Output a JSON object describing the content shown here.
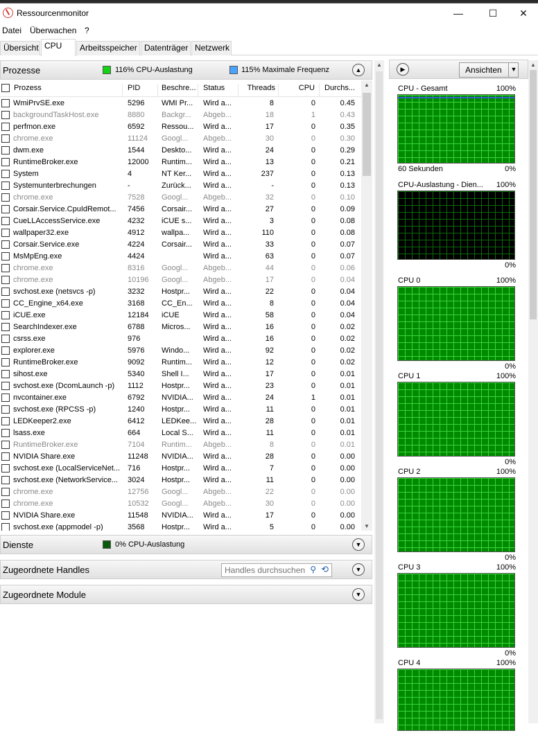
{
  "window": {
    "title": "Ressourcenmonitor",
    "minimize": "—",
    "maximize": "☐",
    "close": "✕"
  },
  "menu": [
    "Datei",
    "Überwachen",
    "?"
  ],
  "tabs": [
    "Übersicht",
    "CPU",
    "Arbeitsspeicher",
    "Datenträger",
    "Netzwerk"
  ],
  "prozesse": {
    "title": "Prozesse",
    "stat1": "116% CPU-Auslastung",
    "stat2": "115% Maximale Frequenz",
    "columns": [
      "Prozess",
      "PID",
      "Beschre...",
      "Status",
      "Threads",
      "CPU",
      "Durchs..."
    ],
    "rows": [
      [
        "WmiPrvSE.exe",
        "5296",
        "WMI Pr...",
        "Wird a...",
        "8",
        "0",
        "0.45",
        false
      ],
      [
        "backgroundTaskHost.exe",
        "8880",
        "Backgr...",
        "Abgeb...",
        "18",
        "1",
        "0.43",
        true
      ],
      [
        "perfmon.exe",
        "6592",
        "Ressou...",
        "Wird a...",
        "17",
        "0",
        "0.35",
        false
      ],
      [
        "chrome.exe",
        "11124",
        "Googl...",
        "Abgeb...",
        "30",
        "0",
        "0.30",
        true
      ],
      [
        "dwm.exe",
        "1544",
        "Deskto...",
        "Wird a...",
        "24",
        "0",
        "0.29",
        false
      ],
      [
        "RuntimeBroker.exe",
        "12000",
        "Runtim...",
        "Wird a...",
        "13",
        "0",
        "0.21",
        false
      ],
      [
        "System",
        "4",
        "NT Ker...",
        "Wird a...",
        "237",
        "0",
        "0.13",
        false
      ],
      [
        "Systemunterbrechungen",
        "-",
        "Zurück...",
        "Wird a...",
        "-",
        "0",
        "0.13",
        false
      ],
      [
        "chrome.exe",
        "7528",
        "Googl...",
        "Abgeb...",
        "32",
        "0",
        "0.10",
        true
      ],
      [
        "Corsair.Service.CpuIdRemot...",
        "7456",
        "Corsair...",
        "Wird a...",
        "27",
        "0",
        "0.09",
        false
      ],
      [
        "CueLLAccessService.exe",
        "4232",
        "iCUE s...",
        "Wird a...",
        "3",
        "0",
        "0.08",
        false
      ],
      [
        "wallpaper32.exe",
        "4912",
        "wallpa...",
        "Wird a...",
        "110",
        "0",
        "0.08",
        false
      ],
      [
        "Corsair.Service.exe",
        "4224",
        "Corsair...",
        "Wird a...",
        "33",
        "0",
        "0.07",
        false
      ],
      [
        "MsMpEng.exe",
        "4424",
        "",
        "Wird a...",
        "63",
        "0",
        "0.07",
        false
      ],
      [
        "chrome.exe",
        "8316",
        "Googl...",
        "Abgeb...",
        "44",
        "0",
        "0.06",
        true
      ],
      [
        "chrome.exe",
        "10196",
        "Googl...",
        "Abgeb...",
        "17",
        "0",
        "0.04",
        true
      ],
      [
        "svchost.exe (netsvcs -p)",
        "3232",
        "Hostpr...",
        "Wird a...",
        "22",
        "0",
        "0.04",
        false
      ],
      [
        "CC_Engine_x64.exe",
        "3168",
        "CC_En...",
        "Wird a...",
        "8",
        "0",
        "0.04",
        false
      ],
      [
        "iCUE.exe",
        "12184",
        "iCUE",
        "Wird a...",
        "58",
        "0",
        "0.04",
        false
      ],
      [
        "SearchIndexer.exe",
        "6788",
        "Micros...",
        "Wird a...",
        "16",
        "0",
        "0.02",
        false
      ],
      [
        "csrss.exe",
        "976",
        "",
        "Wird a...",
        "16",
        "0",
        "0.02",
        false
      ],
      [
        "explorer.exe",
        "5976",
        "Windo...",
        "Wird a...",
        "92",
        "0",
        "0.02",
        false
      ],
      [
        "RuntimeBroker.exe",
        "9092",
        "Runtim...",
        "Wird a...",
        "12",
        "0",
        "0.02",
        false
      ],
      [
        "sihost.exe",
        "5340",
        "Shell I...",
        "Wird a...",
        "17",
        "0",
        "0.01",
        false
      ],
      [
        "svchost.exe (DcomLaunch -p)",
        "1112",
        "Hostpr...",
        "Wird a...",
        "23",
        "0",
        "0.01",
        false
      ],
      [
        "nvcontainer.exe",
        "6792",
        "NVIDIA...",
        "Wird a...",
        "24",
        "1",
        "0.01",
        false
      ],
      [
        "svchost.exe (RPCSS -p)",
        "1240",
        "Hostpr...",
        "Wird a...",
        "11",
        "0",
        "0.01",
        false
      ],
      [
        "LEDKeeper2.exe",
        "6412",
        "LEDKee...",
        "Wird a...",
        "28",
        "0",
        "0.01",
        false
      ],
      [
        "lsass.exe",
        "664",
        "Local S...",
        "Wird a...",
        "11",
        "0",
        "0.01",
        false
      ],
      [
        "RuntimeBroker.exe",
        "7104",
        "Runtim...",
        "Abgeb...",
        "8",
        "0",
        "0.01",
        true
      ],
      [
        "NVIDIA Share.exe",
        "11248",
        "NVIDIA...",
        "Wird a...",
        "28",
        "0",
        "0.00",
        false
      ],
      [
        "svchost.exe (LocalServiceNet...",
        "716",
        "Hostpr...",
        "Wird a...",
        "7",
        "0",
        "0.00",
        false
      ],
      [
        "svchost.exe (NetworkService...",
        "3024",
        "Hostpr...",
        "Wird a...",
        "11",
        "0",
        "0.00",
        false
      ],
      [
        "chrome.exe",
        "12756",
        "Googl...",
        "Abgeb...",
        "22",
        "0",
        "0.00",
        true
      ],
      [
        "chrome.exe",
        "10532",
        "Googl...",
        "Abgeb...",
        "30",
        "0",
        "0.00",
        true
      ],
      [
        "NVIDIA Share.exe",
        "11548",
        "NVIDIA...",
        "Wird a...",
        "17",
        "0",
        "0.00",
        false
      ],
      [
        "svchost.exe (appmodel -p)",
        "3568",
        "Hostpr...",
        "Wird a...",
        "5",
        "0",
        "0.00",
        false
      ]
    ]
  },
  "dienste": {
    "title": "Dienste",
    "stat": "0% CPU-Auslastung"
  },
  "handles": {
    "title": "Zugeordnete Handles",
    "search_placeholder": "Handles durchsuchen"
  },
  "module": {
    "title": "Zugeordnete Module"
  },
  "right_panel": {
    "views_button": "Ansichten"
  },
  "graphs": [
    {
      "title": "CPU - Gesamt",
      "max": "100%",
      "foot_left": "60 Sekunden",
      "foot_right": "0%",
      "usage_fraction": 0.97
    },
    {
      "title": "CPU-Auslastung - Dien...",
      "max": "100%",
      "foot_left": "",
      "foot_right": "0%",
      "usage_fraction": 0.0
    },
    {
      "title": "CPU 0",
      "max": "100%",
      "foot_left": "",
      "foot_right": "0%",
      "usage_fraction": 1.0
    },
    {
      "title": "CPU 1",
      "max": "100%",
      "foot_left": "",
      "foot_right": "0%",
      "usage_fraction": 1.0
    },
    {
      "title": "CPU 2",
      "max": "100%",
      "foot_left": "",
      "foot_right": "0%",
      "usage_fraction": 1.0
    },
    {
      "title": "CPU 3",
      "max": "100%",
      "foot_left": "",
      "foot_right": "0%",
      "usage_fraction": 1.0
    },
    {
      "title": "CPU 4",
      "max": "100%",
      "foot_left": "",
      "foot_right": "",
      "usage_fraction": 1.0
    }
  ],
  "colors": {
    "cpu_usage": "#13d313",
    "max_freq": "#4aa3ff",
    "graph_green": "#008a00",
    "graph_line": "#3cd43c",
    "ended_text": "#8a8a8a"
  },
  "icons": [
    "ressourcenmonitor-app-icon",
    "collapse-chevron-icon",
    "search-icon",
    "refresh-icon",
    "expand-arrow-icon",
    "dropdown-arrow-icon"
  ]
}
